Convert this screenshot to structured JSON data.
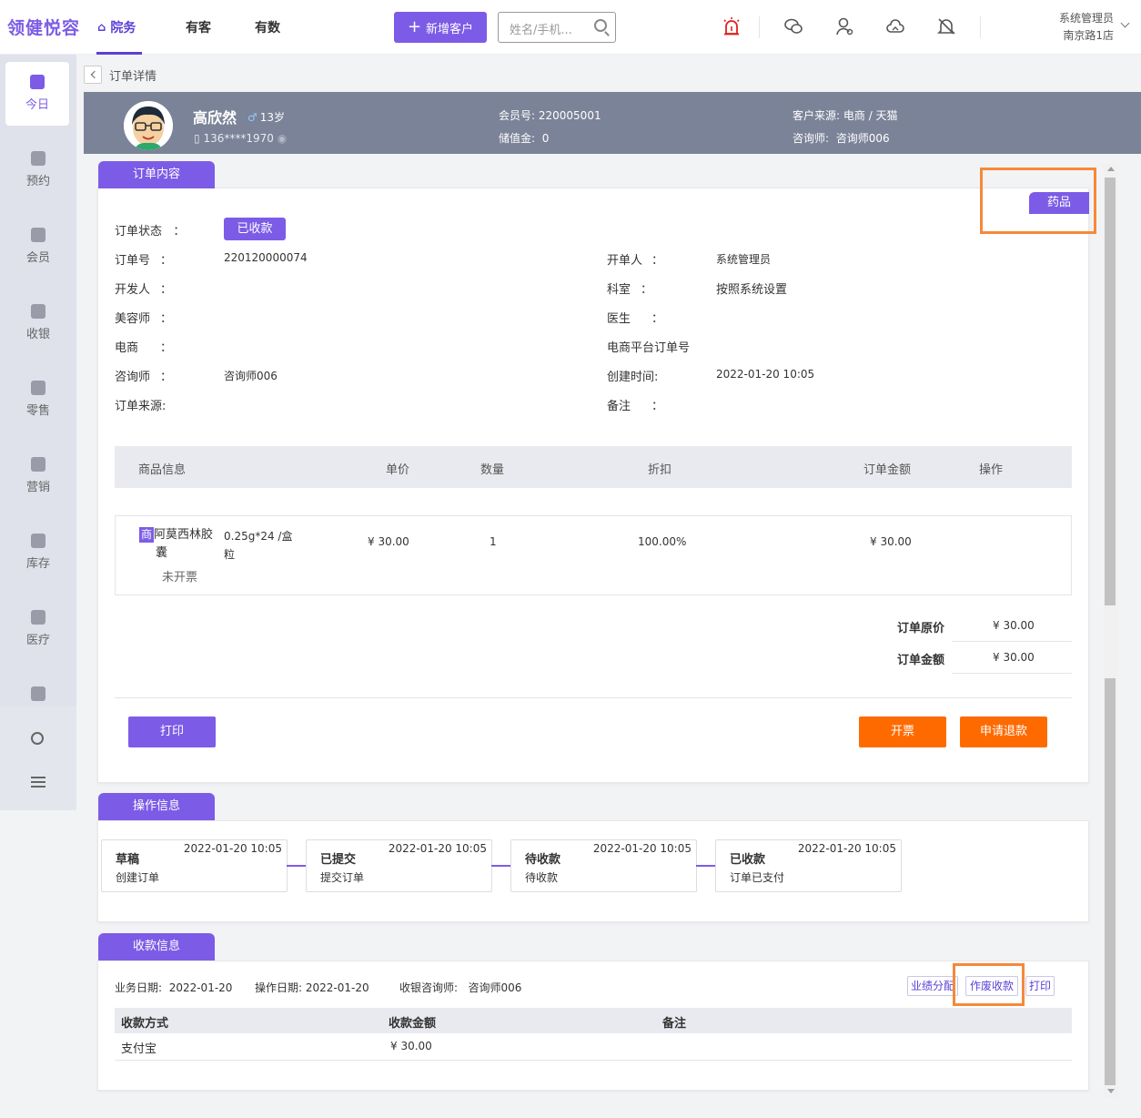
{
  "app": {
    "logo": "领健悦容",
    "nav": [
      {
        "label": "院务",
        "active": true
      },
      {
        "label": "有客",
        "active": false
      },
      {
        "label": "有数",
        "active": false
      }
    ],
    "add_customer": "新增客户",
    "search_placeholder": "姓名/手机...",
    "user": {
      "name": "系统管理员",
      "store": "南京路1店"
    },
    "top_icons": [
      "alarm-icon",
      "wechat-icon",
      "person-icon",
      "cloud-icon",
      "bell-off-icon"
    ]
  },
  "sidebar": {
    "items": [
      {
        "label": "今日",
        "icon": "chart-icon",
        "active": true
      },
      {
        "label": "预约",
        "icon": "calendar-icon"
      },
      {
        "label": "会员",
        "icon": "member-icon"
      },
      {
        "label": "收银",
        "icon": "yen-icon"
      },
      {
        "label": "零售",
        "icon": "bag-icon"
      },
      {
        "label": "营销",
        "icon": "bookmark-icon"
      },
      {
        "label": "库存",
        "icon": "archive-icon"
      },
      {
        "label": "医疗",
        "icon": "medical-icon"
      }
    ]
  },
  "breadcrumb": {
    "title": "订单详情"
  },
  "customer": {
    "name": "高欣然",
    "age": "13岁",
    "gender_symbol": "♂",
    "phone": "136****1970",
    "member_no_label": "会员号:",
    "member_no": "220005001",
    "balance_label": "储值金:",
    "balance": "0",
    "source_label": "客户来源:",
    "source": "电商 / 天猫",
    "consultant_label": "咨询师:",
    "consultant": "咨询师006"
  },
  "order": {
    "tab": "订单内容",
    "tag": "药品",
    "status_label": "订单状态",
    "status": "已收款",
    "fields_left": [
      {
        "label": "订单号",
        "colon": "：",
        "value": "220120000074"
      },
      {
        "label": "开发人",
        "colon": "：",
        "value": ""
      },
      {
        "label": "美容师",
        "colon": "：",
        "value": ""
      },
      {
        "label": "电商",
        "colon": "：",
        "value": ""
      },
      {
        "label": "咨询师",
        "colon": "：",
        "value": "咨询师006"
      },
      {
        "label": "订单来源:",
        "colon": "",
        "value": ""
      }
    ],
    "fields_right": [
      {
        "label": "开单人",
        "colon": "：",
        "value": "系统管理员"
      },
      {
        "label": "科室",
        "colon": "：",
        "value": "按照系统设置"
      },
      {
        "label": "医生",
        "colon": "：",
        "value": ""
      },
      {
        "label": "电商平台订单号",
        "colon": "",
        "value": ""
      },
      {
        "label": "创建时间:",
        "colon": "",
        "value": "2022-01-20 10:05"
      },
      {
        "label": "备注",
        "colon": "：",
        "value": ""
      }
    ],
    "table_headers": [
      "商品信息",
      "单价",
      "数量",
      "折扣",
      "订单金额",
      "操作"
    ],
    "items": [
      {
        "badge": "商",
        "name_line1": "阿莫西林胶",
        "name_line2": "囊",
        "spec_line1": "0.25g*24 /盒",
        "spec_line2": "粒",
        "invoice_status": "未开票",
        "unit_price": "¥ 30.00",
        "quantity": "1",
        "discount": "100.00%",
        "amount": "¥ 30.00"
      }
    ],
    "original_price_label": "订单原价",
    "original_price": "¥ 30.00",
    "total_label": "订单金额",
    "total": "¥ 30.00",
    "print_label": "打印",
    "invoice_label": "开票",
    "refund_label": "申请退款"
  },
  "operations": {
    "tab": "操作信息",
    "steps": [
      {
        "title": "草稿",
        "time": "2022-01-20 10:05",
        "desc": "创建订单"
      },
      {
        "title": "已提交",
        "time": "2022-01-20 10:05",
        "desc": "提交订单"
      },
      {
        "title": "待收款",
        "time": "2022-01-20 10:05",
        "desc": "待收款"
      },
      {
        "title": "已收款",
        "time": "2022-01-20 10:05",
        "desc": "订单已支付"
      }
    ]
  },
  "payment": {
    "tab": "收款信息",
    "business_date_label": "业务日期:",
    "business_date": "2022-01-20",
    "operation_date_label": "操作日期:",
    "operation_date": "2022-01-20",
    "cashier_label": "收银咨询师:",
    "cashier": "咨询师006",
    "buttons": {
      "split": "业绩分配",
      "void": "作废收款",
      "print": "打印"
    },
    "headers": [
      "收款方式",
      "收款金额",
      "备注"
    ],
    "rows": [
      {
        "method": "支付宝",
        "amount": "¥ 30.00",
        "note": ""
      }
    ]
  }
}
